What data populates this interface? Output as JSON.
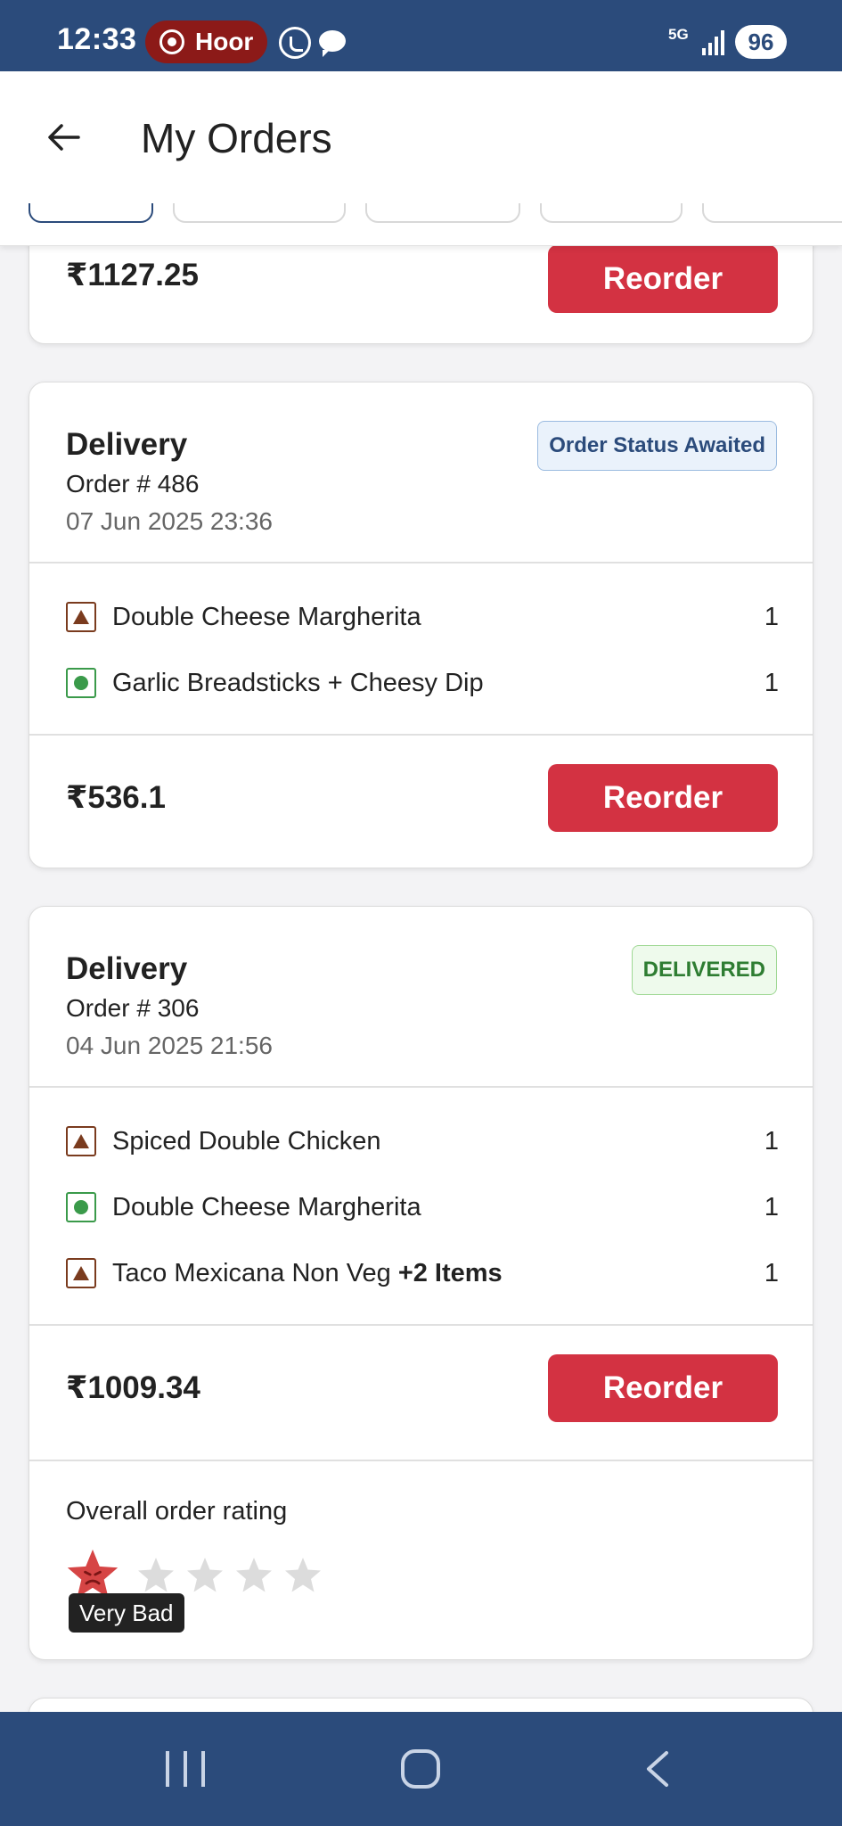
{
  "status_bar": {
    "time": "12:33",
    "recording_label": "Hoor",
    "network_label": "5G",
    "battery": "96"
  },
  "header": {
    "title": "My Orders"
  },
  "orders": [
    {
      "total": "₹1127.25",
      "reorder_label": "Reorder"
    },
    {
      "type": "Delivery",
      "order_no": "Order # 486",
      "date": "07 Jun 2025 23:36",
      "status": "Order Status Awaited",
      "items": [
        {
          "name": "Double Cheese Margherita",
          "qty": "1",
          "diet": "non-veg"
        },
        {
          "name": "Garlic Breadsticks + Cheesy Dip",
          "qty": "1",
          "diet": "veg"
        }
      ],
      "total": "₹536.1",
      "reorder_label": "Reorder"
    },
    {
      "type": "Delivery",
      "order_no": "Order # 306",
      "date": "04 Jun 2025 21:56",
      "status": "DELIVERED",
      "items": [
        {
          "name": "Spiced Double Chicken",
          "qty": "1",
          "diet": "non-veg"
        },
        {
          "name": "Double Cheese Margherita",
          "qty": "1",
          "diet": "veg"
        },
        {
          "name": "Taco Mexicana Non Veg",
          "extra": "+2 Items",
          "qty": "1",
          "diet": "non-veg"
        }
      ],
      "total": "₹1009.34",
      "reorder_label": "Reorder",
      "rating": {
        "label": "Overall order rating",
        "value": 1,
        "max": 5,
        "tooltip": "Very Bad"
      }
    }
  ],
  "colors": {
    "primary": "#2b4b7b",
    "reorder": "#d33242",
    "veg": "#3a9a4a",
    "non_veg": "#7a3b1e"
  }
}
